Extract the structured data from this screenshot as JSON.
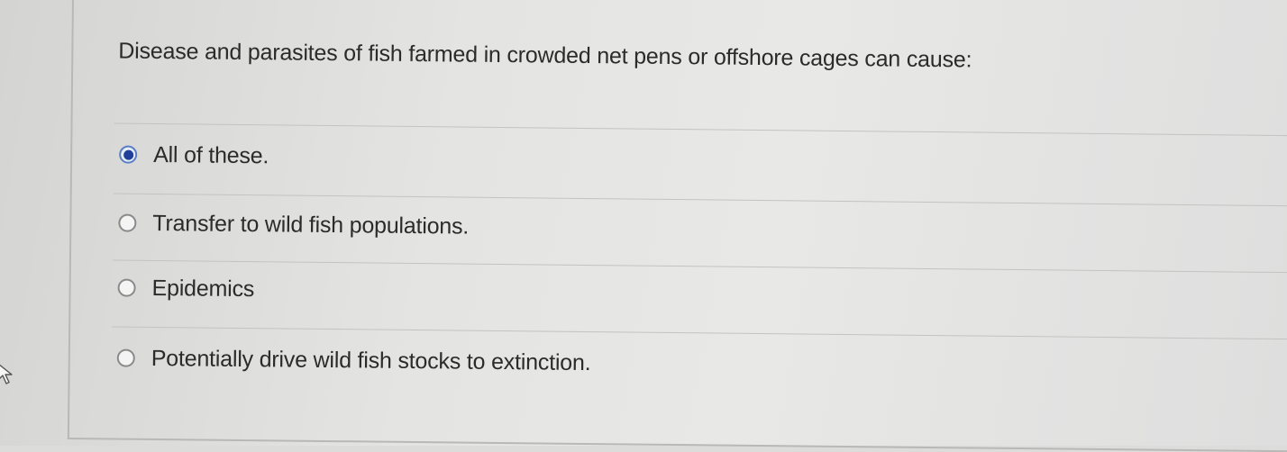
{
  "question": {
    "text": "Disease and parasites of fish farmed in crowded net pens or offshore cages can cause:"
  },
  "options": [
    {
      "label": "All of these.",
      "selected": true
    },
    {
      "label": "Transfer to wild fish populations.",
      "selected": false
    },
    {
      "label": "Epidemics",
      "selected": false
    },
    {
      "label": "Potentially drive wild fish stocks to extinction.",
      "selected": false
    }
  ],
  "colors": {
    "selected_dot": "#1f3f9a",
    "selected_ring": "#5b7fc4",
    "text": "#2b2b2b"
  },
  "icons": {
    "cursor": "mouse-pointer-icon"
  }
}
